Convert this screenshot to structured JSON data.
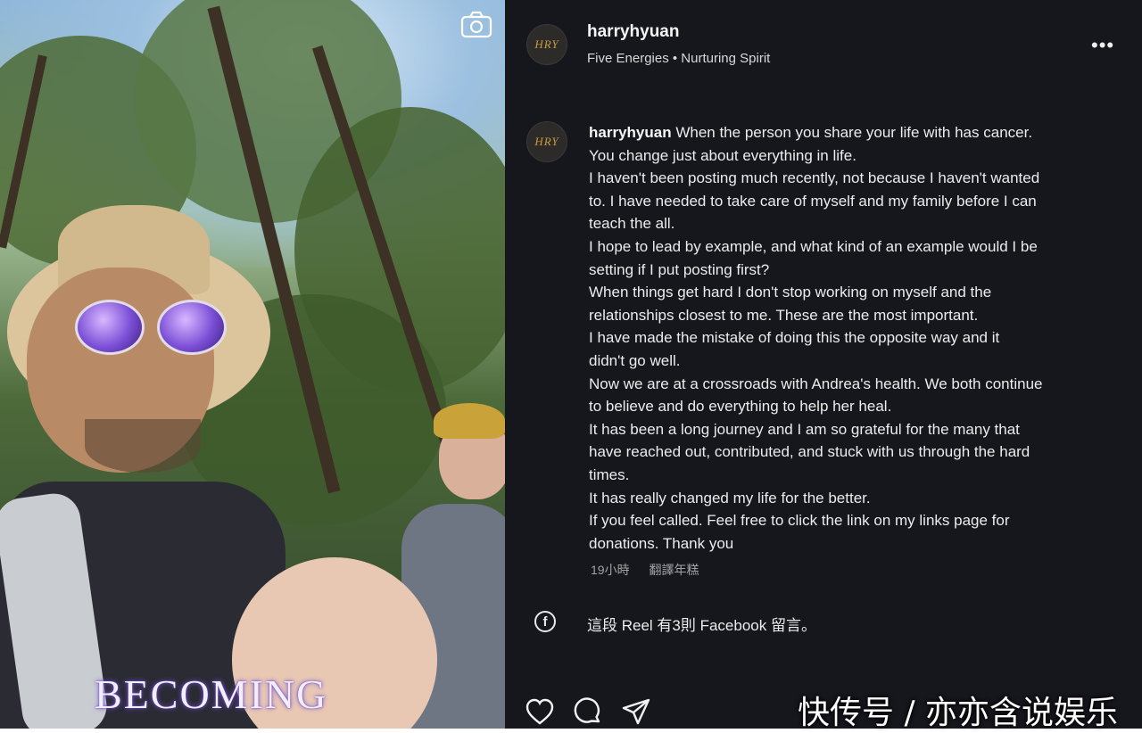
{
  "post": {
    "username": "harryhyuan",
    "subtitle": "Five Energies • Nurturing Spirit",
    "avatar_text": "HRY",
    "caption_username": "harryhyuan",
    "caption_lines": [
      "When the person you share your life with has cancer.",
      "You change just about everything in life.",
      "I haven't been posting much recently, not because I haven't wanted",
      "to. I have needed to take care of myself and my family before I can",
      "teach the all.",
      "I hope to lead by example, and what kind of an example would I be",
      "setting if I put posting first?",
      "When things get hard I don't stop working on myself and the",
      "relationships closest to me. These are the most important.",
      "I have made the mistake of doing this the opposite way and it",
      "didn't go well.",
      "Now we are at a crossroads with Andrea's health. We both continue",
      "to believe and do everything to help her heal.",
      "It has been a long journey and I am so grateful for the many that",
      "have reached out, contributed, and stuck with us through the hard",
      "times.",
      "It has really changed my life for the better.",
      "If you feel called. Feel free to click the link on my links page for",
      "donations. Thank you"
    ],
    "timestamp": "19小時",
    "translate_label": "翻譯年糕",
    "facebook_text": "這段 Reel 有3則 Facebook 留言。"
  },
  "media": {
    "overlay_text": "BECOMING"
  },
  "watermark": "快传号 / 亦亦含说娱乐",
  "colors": {
    "panel_bg": "#16161d",
    "avatar_accent": "#c79a3e",
    "overlay_glow": "#7a56d9"
  },
  "icons": [
    "camera-icon",
    "more-icon",
    "facebook-icon",
    "heart-icon",
    "comment-icon",
    "share-icon"
  ]
}
